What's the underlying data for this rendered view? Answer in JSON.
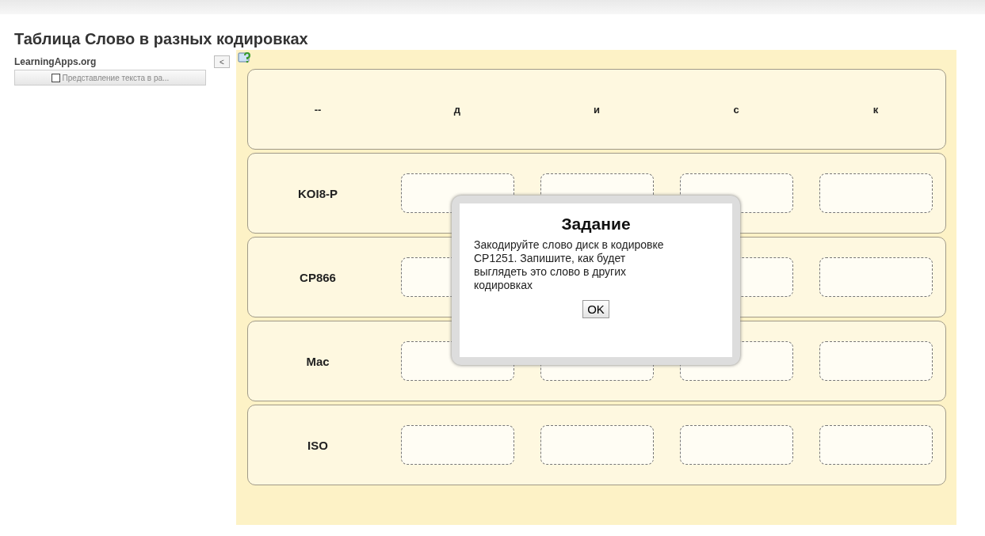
{
  "page_title": "Таблица Слово в разных кодировках",
  "sidebar": {
    "brand": "LearningApps.org",
    "collapse_button": "<",
    "app_button": {
      "label": "Представление текста в ра...",
      "checked": false
    }
  },
  "table": {
    "columns": [
      "--",
      "д",
      "и",
      "с",
      "к"
    ],
    "rows": [
      {
        "label": "KOI8-P"
      },
      {
        "label": "CP866"
      },
      {
        "label": "Mac"
      },
      {
        "label": "ISO"
      }
    ]
  },
  "dialog": {
    "title": "Задание",
    "text": "Закодируйте слово диск в кодировке CP1251. Запишите, как будет выглядеть это слово в других кодировках",
    "button": "OK"
  }
}
